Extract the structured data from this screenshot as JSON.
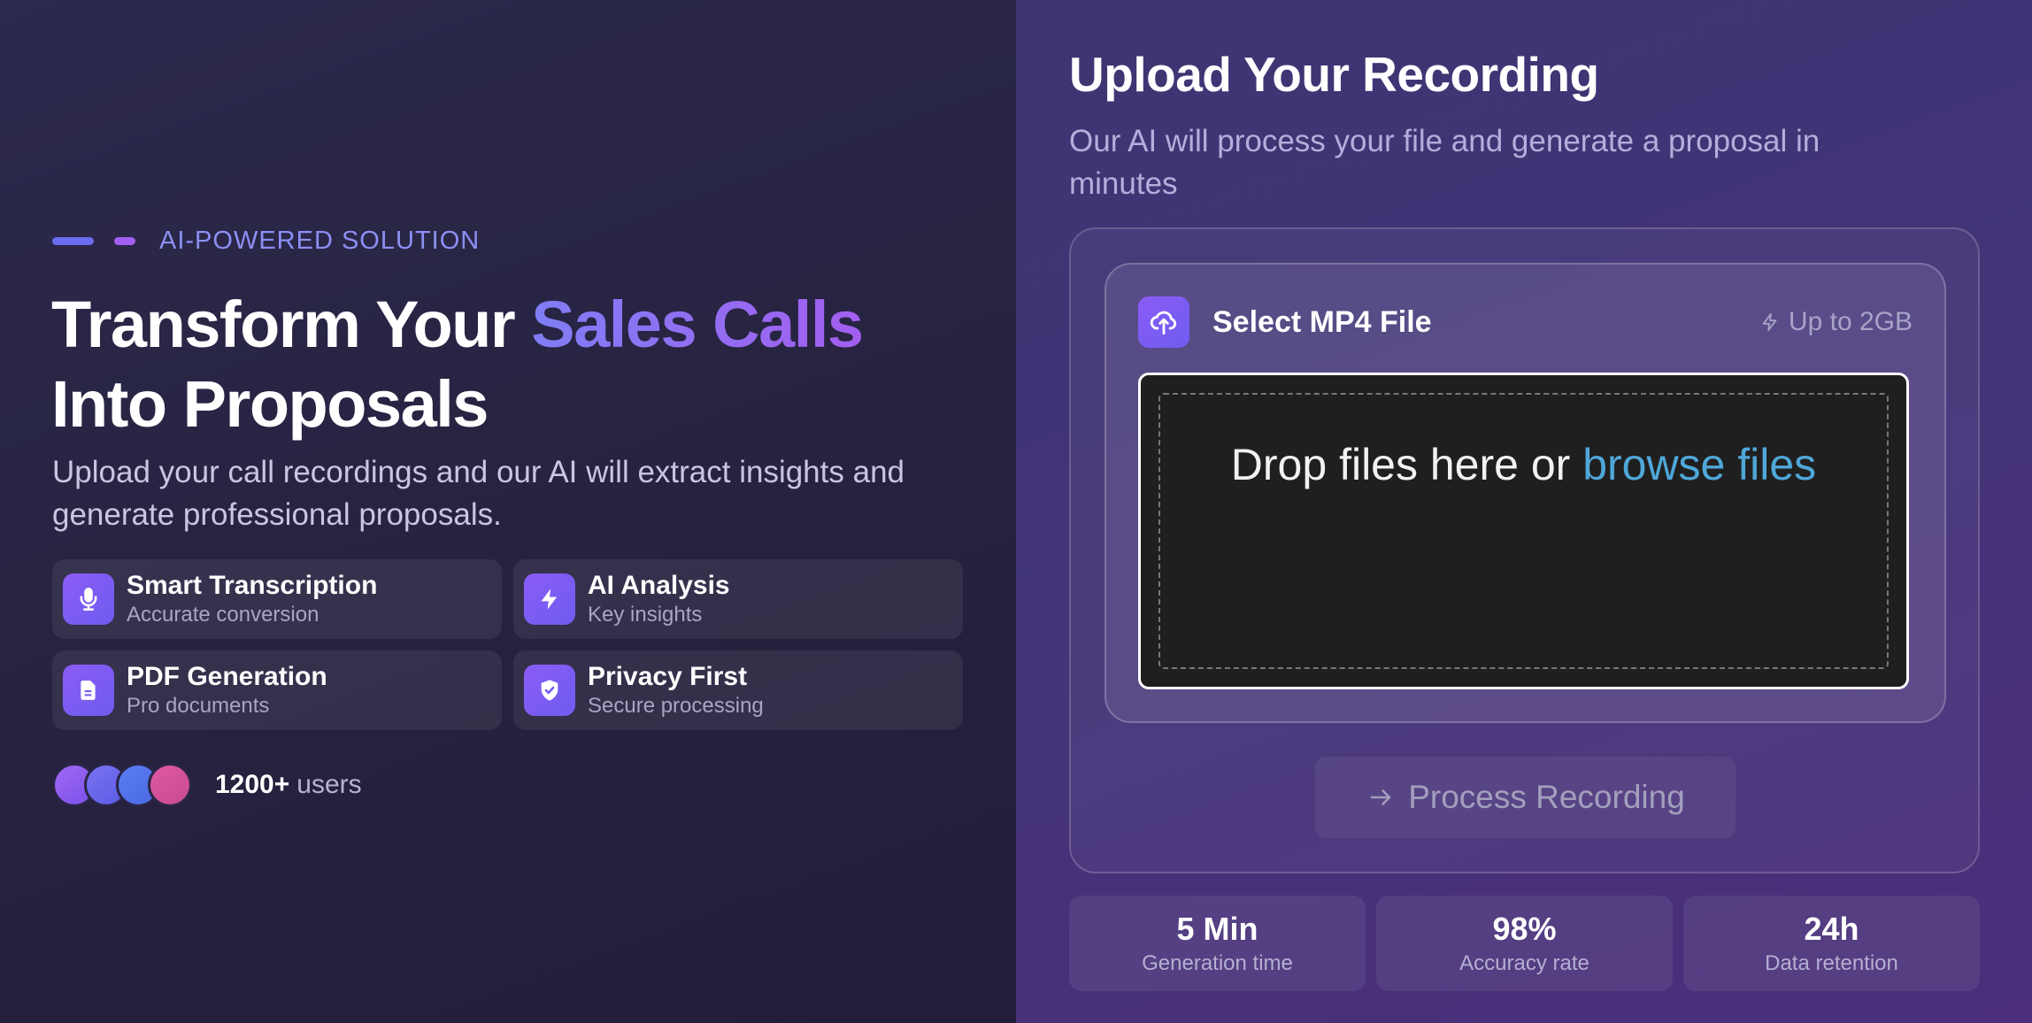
{
  "hero": {
    "eyebrow": "AI-POWERED SOLUTION",
    "headline_part1": "Transform Your ",
    "headline_highlight": "Sales Calls",
    "headline_part2": "Into Proposals",
    "subtitle": "Upload your call recordings and our AI will extract insights and generate professional proposals."
  },
  "features": [
    {
      "icon": "microphone-icon",
      "title": "Smart Transcription",
      "subtitle": "Accurate conversion"
    },
    {
      "icon": "lightning-icon",
      "title": "AI Analysis",
      "subtitle": "Key insights"
    },
    {
      "icon": "document-icon",
      "title": "PDF Generation",
      "subtitle": "Pro documents"
    },
    {
      "icon": "shield-check-icon",
      "title": "Privacy First",
      "subtitle": "Secure processing"
    }
  ],
  "users": {
    "count": "1200+",
    "label": "users"
  },
  "upload": {
    "title": "Upload Your Recording",
    "subtitle": "Our AI will process your file and generate a proposal in minutes",
    "select_label": "Select MP4 File",
    "limit": "Up to 2GB",
    "drop_text": "Drop files here or ",
    "browse_link": "browse files",
    "process_button": "Process Recording"
  },
  "stats": [
    {
      "value": "5 Min",
      "label": "Generation time"
    },
    {
      "value": "98%",
      "label": "Accuracy rate"
    },
    {
      "value": "24h",
      "label": "Data retention"
    }
  ],
  "colors": {
    "accent_blue": "#7f7ef5",
    "accent_purple": "#a35ef0",
    "link": "#4fa7d9"
  }
}
